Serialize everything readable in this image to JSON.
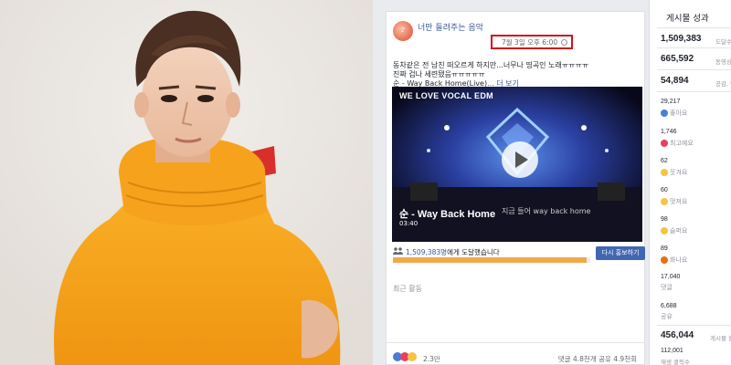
{
  "post": {
    "page_name": "너만 들려주는 음악",
    "timestamp": "7월 3일 오후 6:00",
    "text_line1": "동차같은 전 남친 떠오르게 하지만...너무나 띵곡인 노래ㅠㅠㅠㅠ",
    "text_line2": "진짜 겁나 세련됐음ㅠㅠㅠㅠㅠ",
    "text_line3": "순 - Way Back Home(Live)",
    "more_link": "... 더 보기",
    "video_title": "WE LOVE VOCAL EDM",
    "song_title": "순 - Way Back Home",
    "song_subtitle": "지금 들어 way back home",
    "duration": "03:40",
    "reach_count": "1,509,383명",
    "reach_suffix": "에게 도달했습니다",
    "boost_label": "다시 홍보하기",
    "reach_progress": 0.98,
    "recent_activity": "최근 활동",
    "reaction_count": "2.3만",
    "comments_shares": "댓글 4.8천개  공유 4.9천회"
  },
  "insights": {
    "header": "게시물 성과",
    "reached": {
      "value": "1,509,383",
      "label": "도달수"
    },
    "video_views": {
      "value": "665,592",
      "label": "동영상 조회"
    },
    "engagement": {
      "value": "54,894",
      "label": "공감, 댓글"
    },
    "reactions": [
      {
        "value": "29,217",
        "label": "좋아요",
        "color": "#4a7dd8"
      },
      {
        "value": "1,746",
        "label": "최고예요",
        "color": "#e8415d"
      },
      {
        "value": "62",
        "label": "웃겨요",
        "color": "#f6c443"
      },
      {
        "value": "60",
        "label": "멋져요",
        "color": "#f6c443"
      },
      {
        "value": "98",
        "label": "슬퍼요",
        "color": "#f6c443"
      },
      {
        "value": "89",
        "label": "화나요",
        "color": "#e9710f"
      }
    ],
    "comments": {
      "value": "17,040",
      "label": "댓글"
    },
    "shares": {
      "value": "6,688",
      "label": "공유"
    },
    "post_clicks": {
      "value": "456,044",
      "label": "게시물 클"
    },
    "plays": {
      "value": "112,001",
      "label": "재생 클릭수"
    }
  },
  "colors": {
    "sweater": "#f6a21c",
    "highlight": "#d0111b",
    "fb_blue": "#4267b2"
  }
}
